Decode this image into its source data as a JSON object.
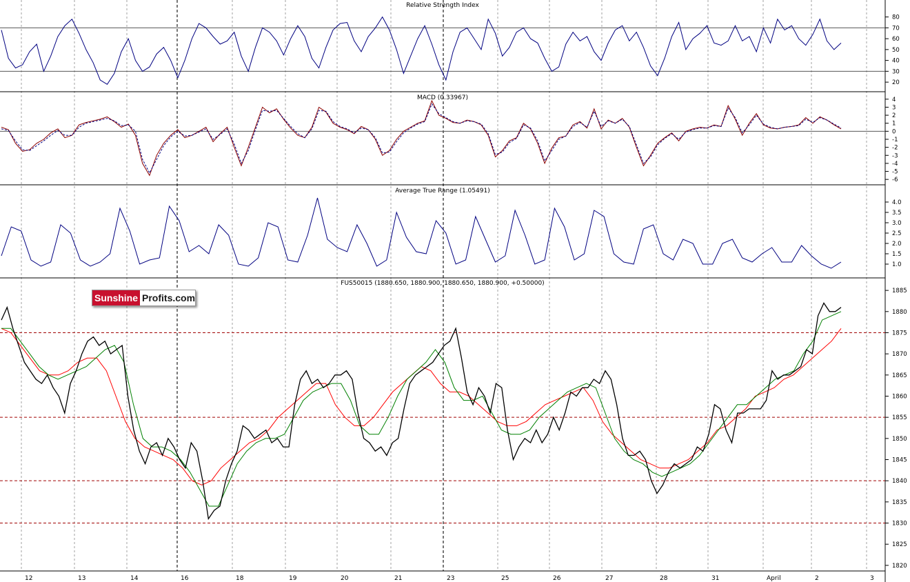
{
  "logo": {
    "part1": "Sunshine",
    "part2": "Profits.com"
  },
  "colors": {
    "price": "#000000",
    "ma_fast": "#008000",
    "ma_slow": "#ff0000",
    "rsi": "#000080",
    "macd": "#8b0000",
    "macd_signal": "#000080",
    "atr": "#000080",
    "support_lines": "#a00000",
    "grid": "#a0a0a0"
  },
  "chart_data": [
    {
      "type": "line",
      "title": "Relative Strength Index",
      "yticks": [
        80,
        70,
        60,
        50,
        40,
        30,
        20
      ],
      "ylim": [
        15,
        88
      ],
      "reference_lines": [
        70,
        30
      ],
      "series": [
        {
          "values": [
            68,
            42,
            33,
            36,
            48,
            55,
            30,
            44,
            62,
            72,
            78,
            65,
            50,
            38,
            22,
            18,
            28,
            48,
            60,
            40,
            30,
            34,
            46,
            52,
            40,
            24,
            40,
            60,
            74,
            70,
            62,
            55,
            58,
            66,
            44,
            30,
            52,
            70,
            66,
            58,
            45,
            60,
            72,
            62,
            42,
            33,
            52,
            68,
            74,
            75,
            58,
            48,
            62,
            70,
            80,
            68,
            50,
            28,
            44,
            60,
            72,
            55,
            36,
            22,
            48,
            66,
            70,
            60,
            50,
            78,
            65,
            44,
            52,
            66,
            70,
            60,
            56,
            42,
            30,
            34,
            55,
            66,
            58,
            62,
            48,
            40,
            56,
            68,
            72,
            58,
            66,
            52,
            35,
            26,
            42,
            62,
            75,
            50,
            60,
            65,
            72,
            56,
            54,
            58,
            72,
            58,
            62,
            48,
            70,
            56,
            78,
            68,
            72,
            60,
            54,
            64,
            78,
            58,
            50,
            56
          ]
        }
      ]
    },
    {
      "type": "line",
      "title": "MACD (0.33967)",
      "yticks": [
        4,
        3,
        2,
        1,
        0,
        -1,
        -2,
        -3,
        -4,
        -5,
        -6
      ],
      "ylim": [
        -6.5,
        4.5
      ],
      "reference_lines": [
        0
      ],
      "series": [
        {
          "values": [
            0.5,
            0.2,
            -1.5,
            -2.5,
            -2.3,
            -1.5,
            -1.0,
            -0.2,
            0.3,
            -0.8,
            -0.5,
            0.8,
            1.1,
            1.3,
            1.5,
            1.8,
            1.2,
            0.5,
            0.9,
            -0.5,
            -4.0,
            -5.5,
            -3.0,
            -1.5,
            -0.5,
            0.2,
            -0.8,
            -0.5,
            0.0,
            0.5,
            -1.3,
            -0.3,
            0.5,
            -2.0,
            -4.3,
            -2.0,
            0.5,
            3.0,
            2.3,
            2.8,
            1.5,
            0.4,
            -0.5,
            -0.8,
            0.5,
            3.0,
            2.4,
            1.0,
            0.5,
            0.2,
            -0.3,
            0.6,
            0.2,
            -1.0,
            -3.0,
            -2.4,
            -1.0,
            0.0,
            0.5,
            1.0,
            1.3,
            3.8,
            2.0,
            1.6,
            1.1,
            1.0,
            1.4,
            1.2,
            0.8,
            -0.5,
            -3.2,
            -2.4,
            -1.2,
            -0.8,
            1.0,
            0.3,
            -1.5,
            -4.0,
            -2.1,
            -0.8,
            -0.6,
            0.8,
            1.2,
            0.4,
            2.8,
            0.3,
            1.4,
            1.0,
            1.6,
            0.5,
            -2.0,
            -4.3,
            -3.0,
            -1.5,
            -0.8,
            -0.2,
            -1.2,
            0.0,
            0.3,
            0.5,
            0.4,
            0.8,
            0.6,
            3.2,
            1.5,
            -0.5,
            1.0,
            2.2,
            0.8,
            0.4,
            0.3,
            0.5,
            0.6,
            0.8,
            1.7,
            1.0,
            1.8,
            1.4,
            0.8,
            0.3
          ]
        },
        {
          "values": [
            0.3,
            0.1,
            -1.2,
            -2.3,
            -2.4,
            -1.8,
            -1.2,
            -0.5,
            0.1,
            -0.5,
            -0.5,
            0.5,
            1.0,
            1.2,
            1.4,
            1.6,
            1.3,
            0.7,
            0.8,
            0.0,
            -3.5,
            -5.2,
            -3.5,
            -1.8,
            -0.7,
            0.0,
            -0.6,
            -0.5,
            -0.1,
            0.3,
            -1.0,
            -0.4,
            0.3,
            -1.6,
            -4.0,
            -2.4,
            0.2,
            2.6,
            2.5,
            2.6,
            1.6,
            0.6,
            -0.3,
            -0.8,
            0.3,
            2.6,
            2.5,
            1.2,
            0.6,
            0.3,
            -0.2,
            0.4,
            0.2,
            -0.8,
            -2.7,
            -2.6,
            -1.3,
            -0.2,
            0.4,
            0.9,
            1.2,
            3.4,
            2.2,
            1.7,
            1.2,
            1.0,
            1.3,
            1.2,
            0.9,
            -0.3,
            -2.9,
            -2.6,
            -1.4,
            -0.9,
            0.8,
            0.4,
            -1.2,
            -3.7,
            -2.4,
            -1.0,
            -0.6,
            0.6,
            1.1,
            0.5,
            2.5,
            0.6,
            1.3,
            1.0,
            1.5,
            0.6,
            -1.7,
            -4.0,
            -3.2,
            -1.7,
            -0.9,
            -0.3,
            -1.0,
            -0.1,
            0.2,
            0.4,
            0.4,
            0.7,
            0.6,
            2.9,
            1.7,
            -0.2,
            0.8,
            2.0,
            0.9,
            0.5,
            0.3,
            0.5,
            0.6,
            0.7,
            1.5,
            1.1,
            1.7,
            1.4,
            0.9,
            0.4
          ]
        }
      ]
    },
    {
      "type": "line",
      "title": "Average True Range (1.05491)",
      "yticks": [
        4.0,
        3.5,
        3.0,
        2.5,
        2.0,
        1.5,
        1.0
      ],
      "ylim": [
        0.5,
        4.4
      ],
      "series": [
        {
          "values": [
            1.4,
            2.8,
            2.6,
            1.2,
            0.9,
            1.1,
            2.9,
            2.5,
            1.2,
            0.9,
            1.1,
            1.5,
            3.7,
            2.6,
            1.0,
            1.2,
            1.3,
            3.8,
            3.1,
            1.6,
            1.9,
            1.5,
            2.9,
            2.4,
            1.0,
            0.9,
            1.3,
            3.0,
            2.8,
            1.2,
            1.1,
            2.4,
            4.2,
            2.2,
            1.8,
            1.6,
            2.9,
            2.0,
            0.9,
            1.2,
            3.5,
            2.3,
            1.6,
            1.5,
            3.1,
            2.5,
            1.0,
            1.2,
            3.3,
            2.2,
            1.1,
            1.4,
            3.6,
            2.4,
            1.0,
            1.2,
            3.7,
            2.8,
            1.2,
            1.5,
            3.6,
            3.3,
            1.5,
            1.1,
            1.0,
            2.7,
            2.9,
            1.5,
            1.2,
            2.2,
            2.0,
            1.0,
            1.0,
            2.0,
            2.2,
            1.3,
            1.1,
            1.5,
            1.8,
            1.1,
            1.1,
            1.9,
            1.4,
            1.0,
            0.8,
            1.1
          ]
        }
      ]
    },
    {
      "type": "line",
      "title": "FUS50015 (1880.650, 1880.900, 1880.650, 1880.900, +0.50000)",
      "yticks": [
        1885,
        1880,
        1875,
        1870,
        1865,
        1860,
        1855,
        1850,
        1845,
        1840,
        1835,
        1830,
        1825,
        1820
      ],
      "ylim": [
        1819,
        1886
      ],
      "x_labels": [
        "12",
        "13",
        "14",
        "16",
        "18",
        "19",
        "20",
        "21",
        "23",
        "25",
        "26",
        "27",
        "28",
        "31",
        "April",
        "2",
        "3"
      ],
      "horizontal_lines": [
        1875,
        1855,
        1840,
        1830
      ],
      "series": [
        {
          "values": [
            1878,
            1881,
            1876,
            1872,
            1868,
            1866,
            1864,
            1863,
            1865,
            1862,
            1860,
            1856,
            1863,
            1866,
            1870,
            1873,
            1874,
            1872,
            1873,
            1870,
            1871,
            1872,
            1860,
            1852,
            1847,
            1844,
            1848,
            1849,
            1846,
            1850,
            1848,
            1845,
            1843,
            1849,
            1847,
            1840,
            1831,
            1833,
            1834,
            1840,
            1844,
            1847,
            1853,
            1852,
            1850,
            1851,
            1852,
            1849,
            1850,
            1848,
            1848,
            1858,
            1864,
            1866,
            1863,
            1864,
            1862,
            1863,
            1865,
            1865,
            1866,
            1864,
            1856,
            1850,
            1849,
            1847,
            1848,
            1846,
            1849,
            1850,
            1857,
            1863,
            1865,
            1866,
            1867,
            1868,
            1870,
            1872,
            1873,
            1876,
            1869,
            1861,
            1858,
            1862,
            1860,
            1856,
            1863,
            1862,
            1852,
            1845,
            1848,
            1850,
            1849,
            1852,
            1849,
            1851,
            1855,
            1852,
            1856,
            1861,
            1860,
            1862,
            1862,
            1864,
            1863,
            1866,
            1864,
            1858,
            1850,
            1846,
            1846,
            1847,
            1845,
            1840,
            1837,
            1839,
            1842,
            1844,
            1843,
            1844,
            1845,
            1848,
            1847,
            1851,
            1858,
            1857,
            1852,
            1849,
            1856,
            1856,
            1857,
            1857,
            1857,
            1859,
            1866,
            1864,
            1865,
            1865,
            1866,
            1867,
            1871,
            1870,
            1879,
            1882,
            1880,
            1880,
            1881
          ]
        },
        {
          "values": [
            1876,
            1876,
            1873,
            1870,
            1867,
            1865,
            1864,
            1865,
            1866,
            1867,
            1869,
            1871,
            1872,
            1868,
            1858,
            1850,
            1848,
            1848,
            1847,
            1845,
            1842,
            1838,
            1834,
            1834,
            1839,
            1844,
            1847,
            1849,
            1850,
            1850,
            1851,
            1855,
            1859,
            1861,
            1862,
            1863,
            1863,
            1859,
            1853,
            1851,
            1851,
            1855,
            1860,
            1864,
            1866,
            1868,
            1871,
            1868,
            1862,
            1859,
            1859,
            1860,
            1856,
            1852,
            1851,
            1851,
            1852,
            1855,
            1857,
            1859,
            1861,
            1862,
            1863,
            1862,
            1856,
            1850,
            1847,
            1845,
            1844,
            1842,
            1841,
            1842,
            1843,
            1844,
            1846,
            1849,
            1852,
            1855,
            1858,
            1858,
            1860,
            1862,
            1864,
            1865,
            1866,
            1870,
            1873,
            1878,
            1879,
            1880
          ]
        },
        {
          "values": [
            1876,
            1875,
            1872,
            1869,
            1866,
            1865,
            1865,
            1866,
            1868,
            1869,
            1869,
            1866,
            1860,
            1854,
            1850,
            1848,
            1847,
            1846,
            1845,
            1843,
            1840,
            1839,
            1840,
            1843,
            1845,
            1847,
            1849,
            1850,
            1852,
            1855,
            1857,
            1859,
            1861,
            1863,
            1863,
            1858,
            1855,
            1853,
            1853,
            1855,
            1858,
            1861,
            1863,
            1865,
            1867,
            1866,
            1863,
            1861,
            1861,
            1860,
            1858,
            1856,
            1854,
            1853,
            1853,
            1854,
            1856,
            1858,
            1859,
            1860,
            1861,
            1862,
            1859,
            1854,
            1851,
            1849,
            1847,
            1845,
            1844,
            1843,
            1843,
            1844,
            1845,
            1847,
            1849,
            1852,
            1853,
            1855,
            1857,
            1860,
            1861,
            1862,
            1864,
            1865,
            1867,
            1869,
            1871,
            1873,
            1876
          ]
        }
      ]
    }
  ]
}
